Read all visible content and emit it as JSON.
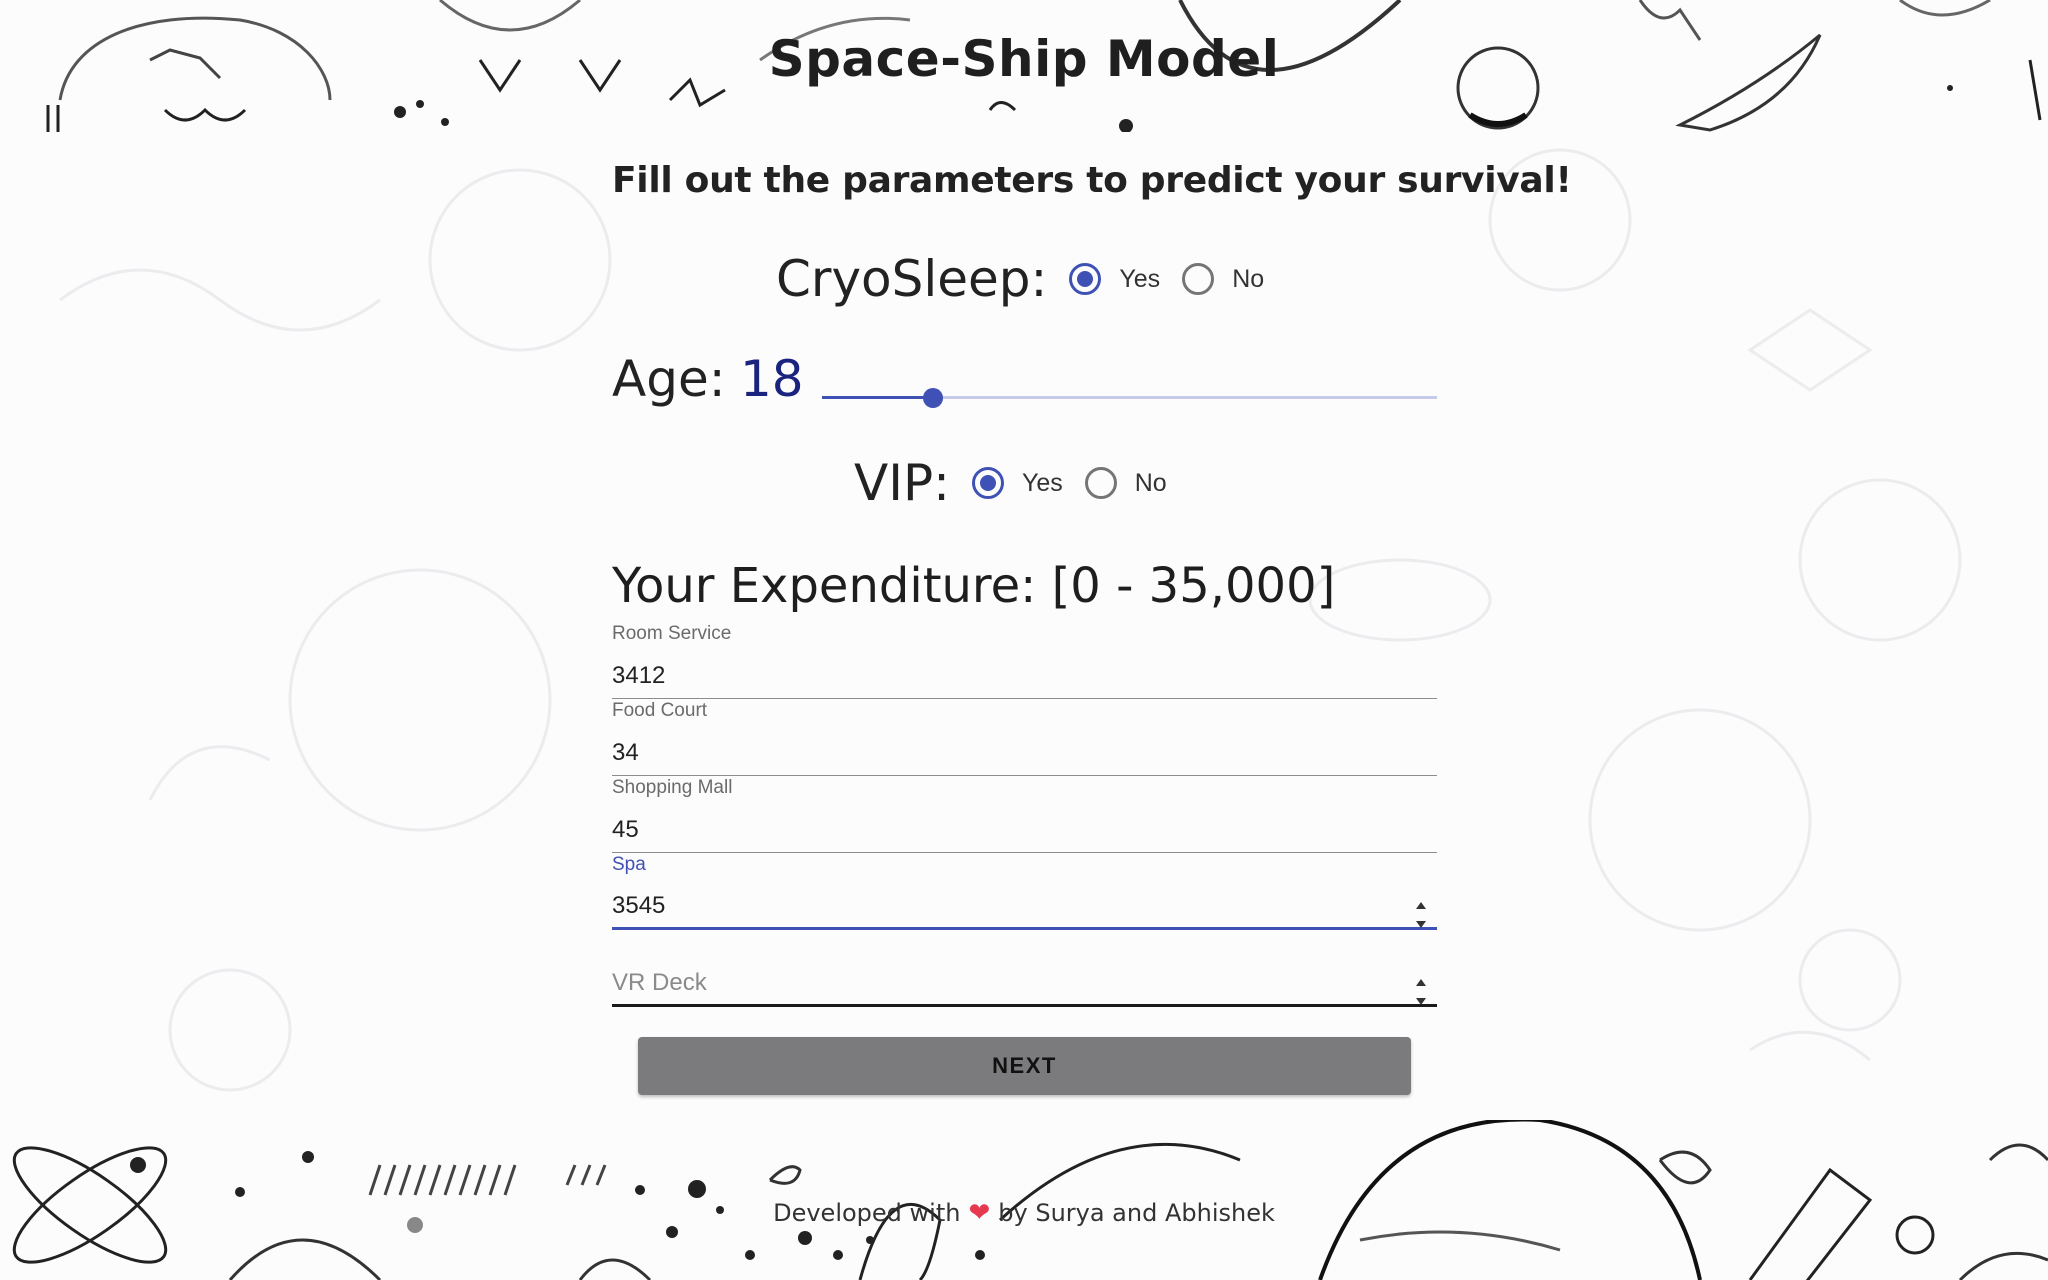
{
  "header": {
    "title": "Space-Ship Model"
  },
  "form": {
    "subtitle": "Fill out the parameters to predict your survival!",
    "cryosleep": {
      "label": "CryoSleep:",
      "options": [
        {
          "label": "Yes",
          "checked": true
        },
        {
          "label": "No",
          "checked": false
        }
      ]
    },
    "age": {
      "label": "Age:",
      "value": "18",
      "slider_fraction": 0.18
    },
    "vip": {
      "label": "VIP:",
      "options": [
        {
          "label": "Yes",
          "checked": true
        },
        {
          "label": "No",
          "checked": false
        }
      ]
    },
    "expenditure_heading": "Your Expenditure: [0 - 35,000]",
    "fields": [
      {
        "label": "Room Service",
        "value": "3412",
        "placeholder": ""
      },
      {
        "label": "Food Court",
        "value": "34",
        "placeholder": ""
      },
      {
        "label": "Shopping Mall",
        "value": "45",
        "placeholder": ""
      },
      {
        "label": "Spa",
        "value": "3545",
        "placeholder": ""
      },
      {
        "label": "",
        "value": "",
        "placeholder": "VR Deck"
      }
    ],
    "next_label": "NEXT"
  },
  "footer": {
    "prefix": "Developed with",
    "heart": "❤",
    "suffix": "by Surya and Abhishek"
  },
  "colors": {
    "accent": "#3f51b5",
    "age_value": "#1a237e",
    "button": "#7b7b7d",
    "heart": "#e53950"
  },
  "icons": {
    "radio": "radio-button-icon",
    "spin": "number-spinner-icon",
    "heart": "heart-icon"
  }
}
